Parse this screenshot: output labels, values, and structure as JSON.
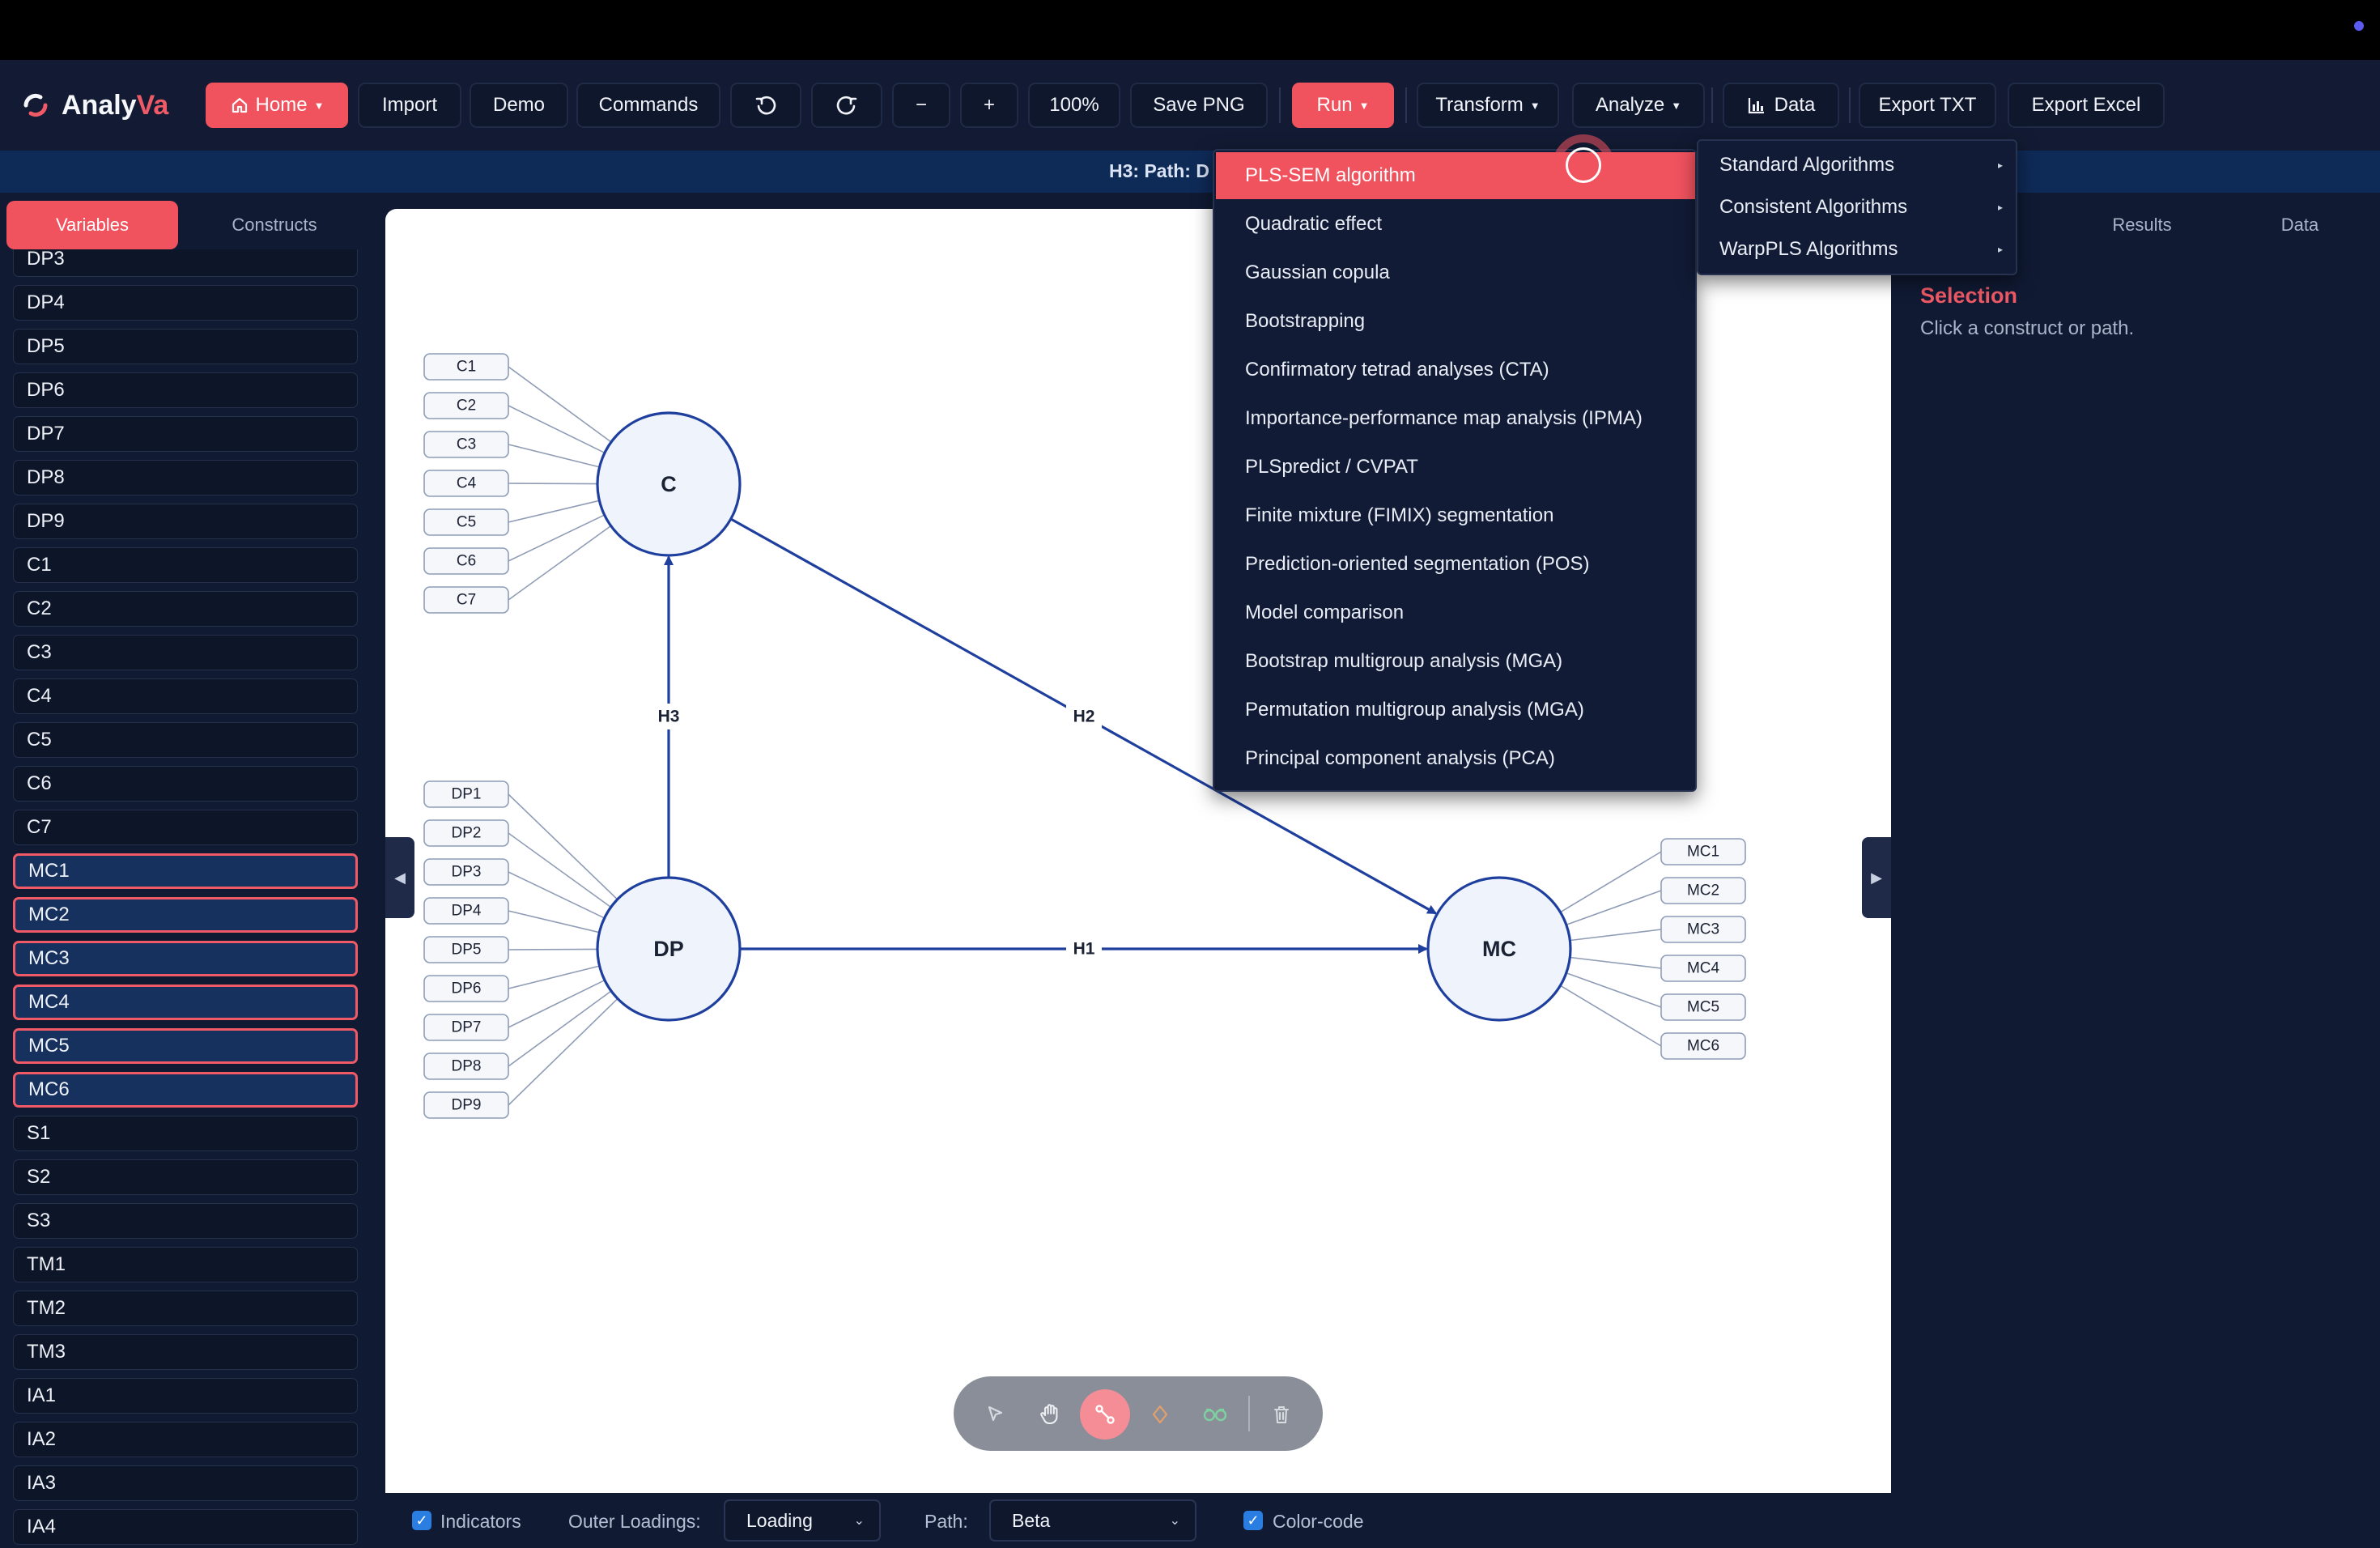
{
  "app": {
    "name_part1": "Analy",
    "name_part2": "Va"
  },
  "toolbar": {
    "home": "Home",
    "import": "Import",
    "demo": "Demo",
    "commands": "Commands",
    "zoom_out": "−",
    "zoom_in": "+",
    "zoom_level": "100%",
    "save_png": "Save PNG",
    "run": "Run",
    "transform": "Transform",
    "analyze": "Analyze",
    "data": "Data",
    "export_txt": "Export TXT",
    "export_excel": "Export Excel"
  },
  "header_bar": {
    "text": "H3: Path: D"
  },
  "left_tabs": {
    "variables": "Variables",
    "constructs": "Constructs"
  },
  "variables": [
    "DP3",
    "DP4",
    "DP5",
    "DP6",
    "DP7",
    "DP8",
    "DP9",
    "C1",
    "C2",
    "C3",
    "C4",
    "C5",
    "C6",
    "C7",
    "MC1",
    "MC2",
    "MC3",
    "MC4",
    "MC5",
    "MC6",
    "S1",
    "S2",
    "S3",
    "TM1",
    "TM2",
    "TM3",
    "IA1",
    "IA2",
    "IA3",
    "IA4"
  ],
  "selected_variables": [
    "MC1",
    "MC2",
    "MC3",
    "MC4",
    "MC5",
    "MC6"
  ],
  "model": {
    "constructs": {
      "c": "C",
      "dp": "DP",
      "mc": "MC"
    },
    "indicators_c": [
      "C1",
      "C2",
      "C3",
      "C4",
      "C5",
      "C6",
      "C7"
    ],
    "indicators_dp": [
      "DP1",
      "DP2",
      "DP3",
      "DP4",
      "DP5",
      "DP6",
      "DP7",
      "DP8",
      "DP9"
    ],
    "indicators_mc": [
      "MC1",
      "MC2",
      "MC3",
      "MC4",
      "MC5",
      "MC6"
    ],
    "paths": {
      "h1": "H1",
      "h2": "H2",
      "h3": "H3"
    }
  },
  "run_menu": {
    "items": [
      "PLS-SEM algorithm",
      "Quadratic effect",
      "Gaussian copula",
      "Bootstrapping",
      "Confirmatory tetrad analyses (CTA)",
      "Importance-performance map analysis (IPMA)",
      "PLSpredict / CVPAT",
      "Finite mixture (FIMIX) segmentation",
      "Prediction-oriented segmentation (POS)",
      "Model comparison",
      "Bootstrap multigroup analysis (MGA)",
      "Permutation multigroup analysis (MGA)",
      "Principal component analysis (PCA)"
    ]
  },
  "sub_menu": {
    "items": [
      "Standard Algorithms",
      "Consistent Algorithms",
      "WarpPLS Algorithms"
    ]
  },
  "right_tabs": {
    "results": "Results",
    "data": "Data"
  },
  "selection": {
    "title": "Selection",
    "hint": "Click a construct or path."
  },
  "bottom": {
    "indicators_label": "Indicators",
    "outer_loadings_label": "Outer Loadings:",
    "outer_loadings_value": "Loading",
    "path_label": "Path:",
    "path_value": "Beta",
    "color_code_label": "Color-code"
  },
  "colors": {
    "accent": "#f0525e",
    "construct_fill": "#eef3fc",
    "path": "#1f3f9e",
    "selected_bg": "#17315e"
  }
}
